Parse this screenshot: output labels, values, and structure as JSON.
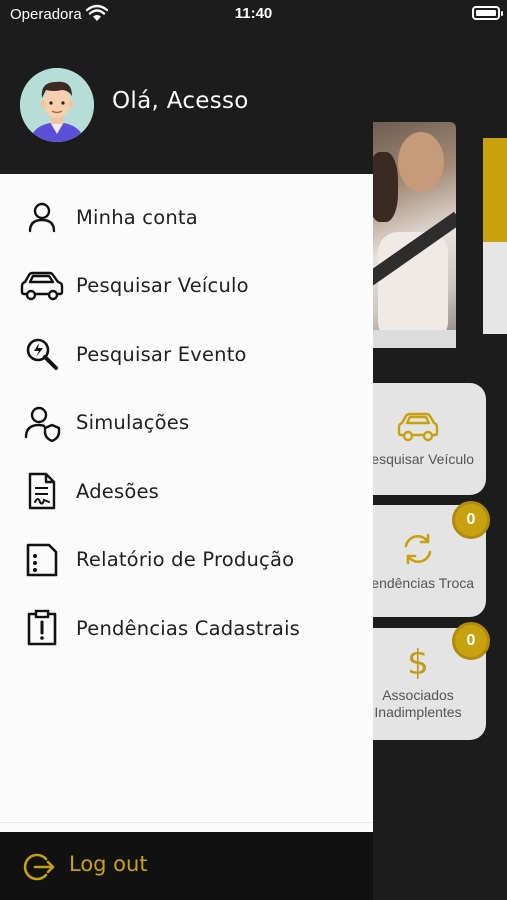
{
  "status_bar": {
    "carrier": "Operadora",
    "time": "11:40"
  },
  "drawer": {
    "greeting": "Olá, Acesso",
    "menu": [
      {
        "label": "Minha conta",
        "icon": "user-icon"
      },
      {
        "label": "Pesquisar Veículo",
        "icon": "car-icon"
      },
      {
        "label": "Pesquisar Evento",
        "icon": "search-event-icon"
      },
      {
        "label": "Simulações",
        "icon": "user-shield-icon"
      },
      {
        "label": "Adesões",
        "icon": "signed-document-icon"
      },
      {
        "label": "Relatório de Produção",
        "icon": "report-icon"
      },
      {
        "label": "Pendências Cadastrais",
        "icon": "clipboard-alert-icon"
      }
    ],
    "logout_label": "Log out"
  },
  "background": {
    "cards": [
      {
        "label": "Pesquisar Veículo",
        "icon": "car-icon"
      },
      {
        "label": "Pendências Troca",
        "icon": "refresh-icon",
        "badge": "0"
      },
      {
        "label": "Associados Inadimplentes",
        "icon": "dollar-icon",
        "badge": "0"
      }
    ]
  },
  "colors": {
    "accent": "#C7A20E",
    "drawer_header": "#1C1C1C",
    "drawer_bg": "#FBFBFB",
    "logout_bg": "#111111"
  }
}
